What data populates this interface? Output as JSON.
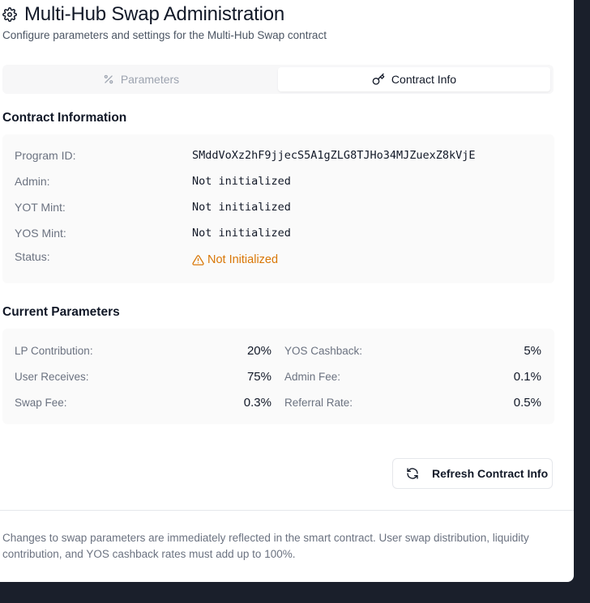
{
  "header": {
    "title": "Multi-Hub Swap Administration",
    "subtitle": "Configure parameters and settings for the Multi-Hub Swap contract"
  },
  "tabs": [
    {
      "label": "Parameters",
      "icon": "percent-icon",
      "active": false
    },
    {
      "label": "Contract Info",
      "icon": "key-icon",
      "active": true
    }
  ],
  "contract_info": {
    "title": "Contract Information",
    "rows": [
      {
        "label": "Program ID:",
        "value": "SMddVoXz2hF9jjecS5A1gZLG8TJHo34MJZuexZ8kVjE"
      },
      {
        "label": "Admin:",
        "value": "Not initialized"
      },
      {
        "label": "YOT Mint:",
        "value": "Not initialized"
      },
      {
        "label": "YOS Mint:",
        "value": "Not initialized"
      }
    ],
    "status": {
      "label": "Status:",
      "value": "Not Initialized",
      "icon": "warning-triangle-icon",
      "color": "#d97706"
    }
  },
  "current_parameters": {
    "title": "Current Parameters",
    "left": [
      {
        "label": "LP Contribution:",
        "value": "20%"
      },
      {
        "label": "User Receives:",
        "value": "75%"
      },
      {
        "label": "Swap Fee:",
        "value": "0.3%"
      }
    ],
    "right": [
      {
        "label": "YOS Cashback:",
        "value": "5%"
      },
      {
        "label": "Admin Fee:",
        "value": "0.1%"
      },
      {
        "label": "Referral Rate:",
        "value": "0.5%"
      }
    ]
  },
  "actions": {
    "refresh_label": "Refresh Contract Info",
    "refresh_icon": "refresh-icon"
  },
  "footer": {
    "note": "Changes to swap parameters are immediately reflected in the smart contract. User swap distribution, liquidity contribution, and YOS cashback rates must add up to 100%."
  }
}
